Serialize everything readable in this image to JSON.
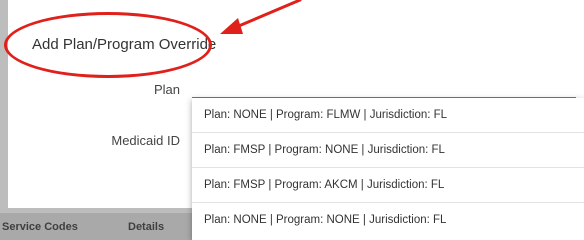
{
  "background": {
    "tabs": [
      "Service Codes",
      "Details"
    ]
  },
  "modal": {
    "title": "Add Plan/Program Override",
    "plan_label": "Plan",
    "medicaid_label": "Medicaid ID"
  },
  "dropdown": {
    "options": [
      "Plan: NONE | Program: FLMW | Jurisdiction: FL",
      "Plan: FMSP | Program: NONE | Jurisdiction: FL",
      "Plan: FMSP | Program: AKCM | Jurisdiction: FL",
      "Plan: NONE | Program: NONE | Jurisdiction: FL"
    ]
  },
  "annotation": {
    "color": "#e0201b"
  }
}
